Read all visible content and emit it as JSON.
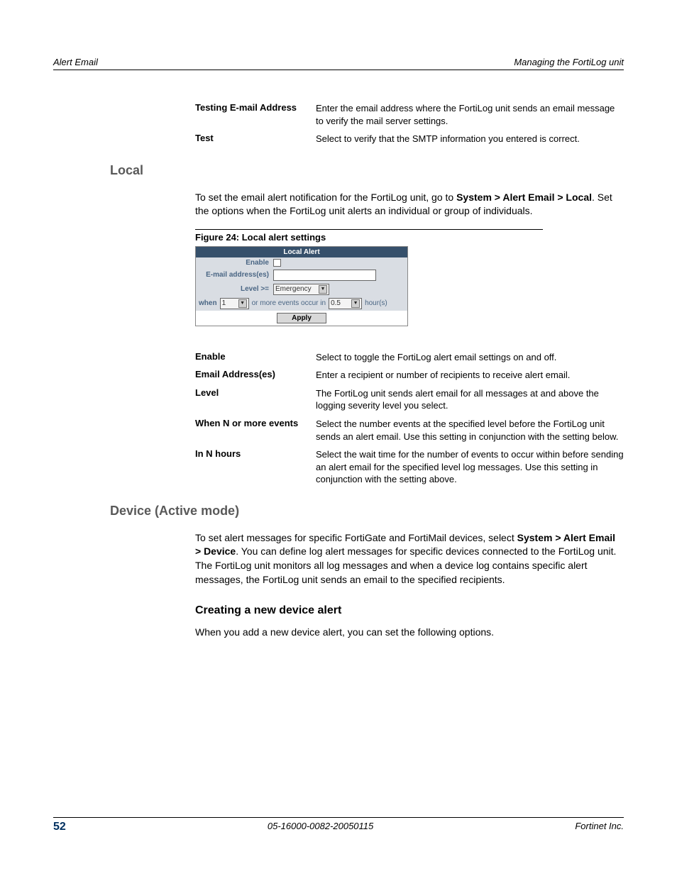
{
  "header": {
    "left": "Alert Email",
    "right": "Managing the FortiLog unit"
  },
  "defs_top": [
    {
      "term": "Testing E-mail Address",
      "desc": "Enter the email address where the FortiLog unit sends an email message to verify the mail server settings."
    },
    {
      "term": "Test",
      "desc": "Select to verify that the SMTP information you entered is correct."
    }
  ],
  "sections": {
    "local_heading": "Local",
    "local_para_pre": "To set the email alert notification for the FortiLog unit, go to ",
    "local_para_b1": "System > Alert Email > Local",
    "local_para_post": ". Set the options when the FortiLog unit alerts an individual or group of individuals.",
    "figure_caption": "Figure 24: Local alert settings",
    "device_heading": "Device (Active mode)",
    "device_para_pre": "To set alert messages for specific FortiGate and FortiMail devices, select ",
    "device_para_b1": "System > Alert Email > Device",
    "device_para_post": ". You can define log alert messages for specific devices connected to the FortiLog unit. The FortiLog unit monitors all log messages and when a device log contains specific alert messages, the FortiLog unit sends an email to the specified recipients.",
    "create_heading": "Creating a new device alert",
    "create_para": "When you add a new device alert, you can set the following options."
  },
  "screenshot": {
    "title": "Local Alert",
    "enable": "Enable",
    "email_addresses": "E-mail address(es)",
    "level": "Level >=",
    "level_value": "Emergency",
    "when_label": "when",
    "when_value": "1",
    "events_text": "or more events occur in",
    "hours_value": "0.5",
    "hours_label": "hour(s)",
    "apply": "Apply"
  },
  "defs_bottom": [
    {
      "term": "Enable",
      "desc": "Select to toggle the FortiLog alert email settings on and off."
    },
    {
      "term": "Email Address(es)",
      "desc": "Enter a recipient or number of recipients to receive alert email."
    },
    {
      "term": "Level",
      "desc": "The FortiLog unit sends alert email for all messages at and above the logging severity level you select."
    },
    {
      "term": "When N or more events",
      "desc": "Select the number events at the specified level before the FortiLog unit sends an alert email. Use this setting in conjunction with the setting below."
    },
    {
      "term": "In N hours",
      "desc": "Select the wait time for the number of events to occur within before sending an alert email for the specified level log messages. Use this setting in conjunction with the setting above."
    }
  ],
  "footer": {
    "page": "52",
    "center": "05-16000-0082-20050115",
    "right": "Fortinet Inc."
  }
}
